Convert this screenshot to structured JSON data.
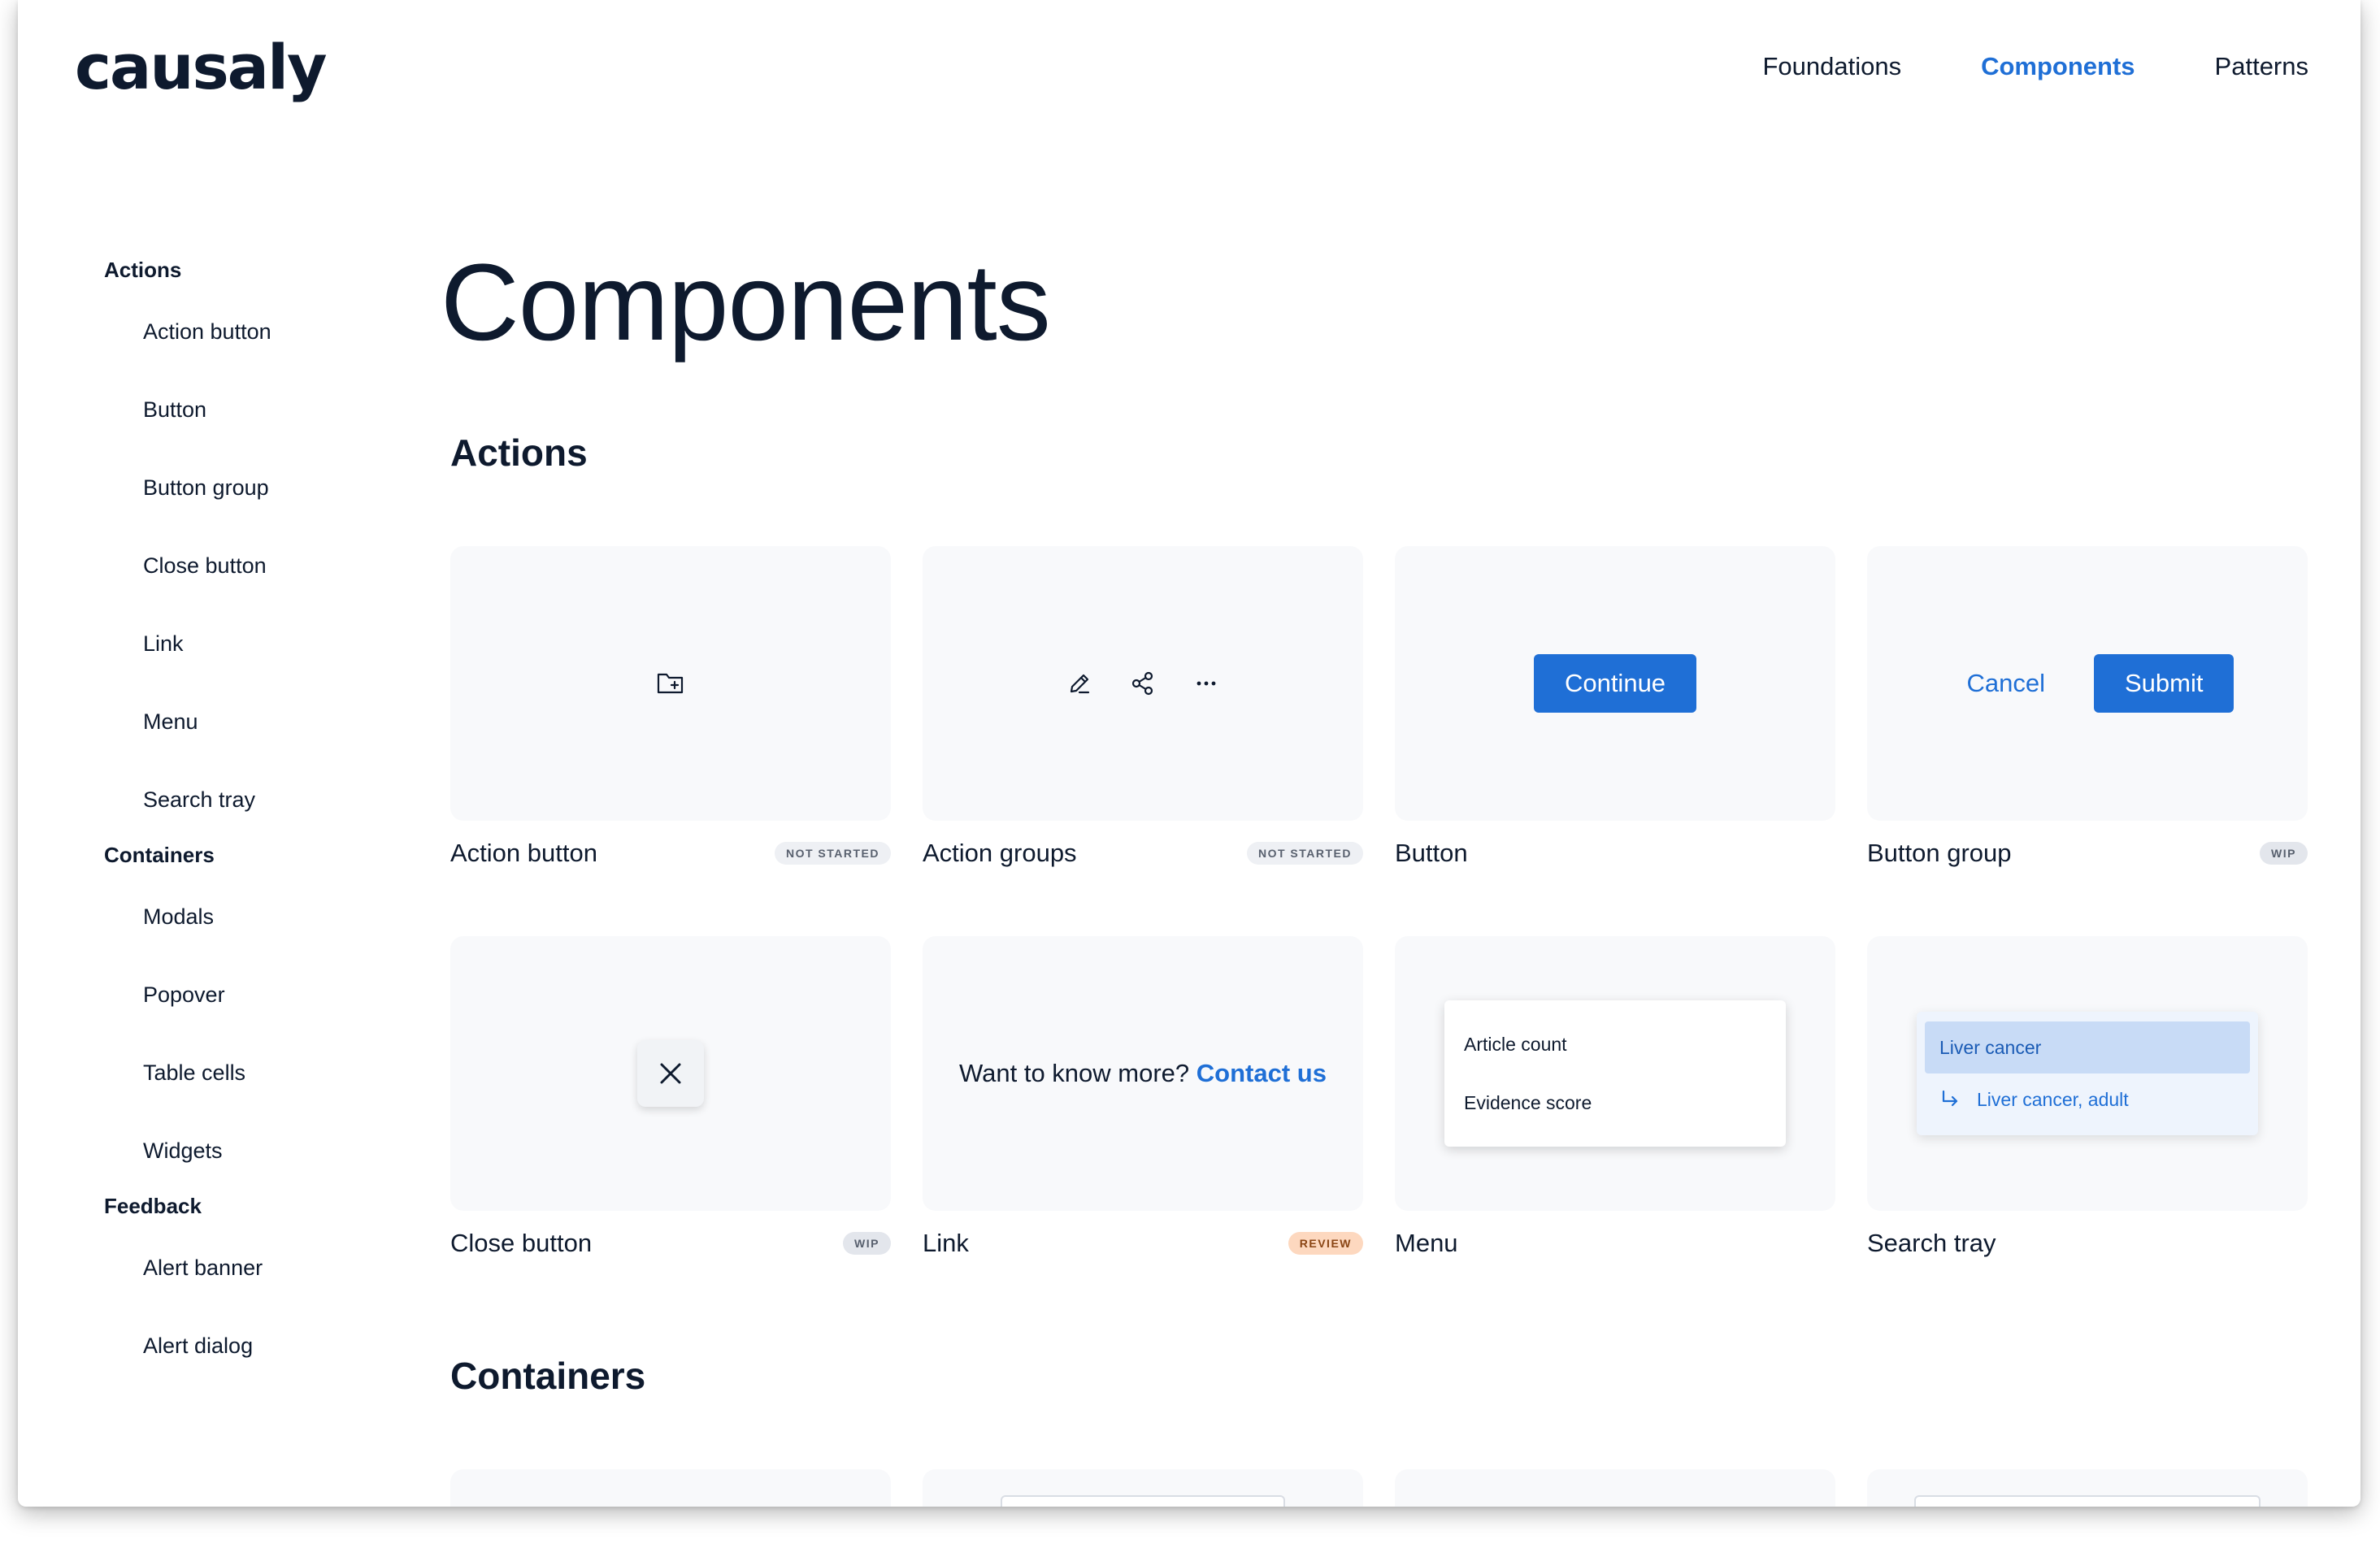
{
  "header": {
    "logo": "causaly",
    "nav": [
      {
        "label": "Foundations",
        "active": false
      },
      {
        "label": "Components",
        "active": true
      },
      {
        "label": "Patterns",
        "active": false
      }
    ]
  },
  "sidebar": {
    "groups": [
      {
        "title": "Actions",
        "items": [
          "Action button",
          "Button",
          "Button group",
          "Close button",
          "Link",
          "Menu",
          "Search tray"
        ]
      },
      {
        "title": "Containers",
        "items": [
          "Modals",
          "Popover",
          "Table cells",
          "Widgets"
        ]
      },
      {
        "title": "Feedback",
        "items": [
          "Alert banner",
          "Alert dialog"
        ]
      }
    ]
  },
  "main": {
    "title": "Components",
    "sections": [
      {
        "title": "Actions",
        "cards": [
          {
            "name": "Action button",
            "status": "NOT STARTED",
            "preview_icon": "folder-plus-icon"
          },
          {
            "name": "Action groups",
            "status": "NOT STARTED",
            "preview_icons": [
              "edit-pen-icon",
              "share-icon",
              "more-horizontal-icon"
            ]
          },
          {
            "name": "Button",
            "status": "",
            "button_label": "Continue"
          },
          {
            "name": "Button group",
            "status": "WIP",
            "cancel_label": "Cancel",
            "submit_label": "Submit"
          },
          {
            "name": "Close button",
            "status": "WIP",
            "preview_icon": "close-icon"
          },
          {
            "name": "Link",
            "status": "REVIEW",
            "text": "Want to know more?",
            "link_text": "Contact us"
          },
          {
            "name": "Menu",
            "status": "",
            "menu_items": [
              "Article count",
              "Evidence score"
            ]
          },
          {
            "name": "Search tray",
            "status": "",
            "tray_items": [
              "Liver cancer",
              "Liver cancer, adult"
            ]
          }
        ]
      },
      {
        "title": "Containers",
        "cards": []
      }
    ]
  },
  "colors": {
    "accent": "#1f6fd6",
    "text": "#0e1a2e",
    "card_bg": "#f8f9fb",
    "badge_review_bg": "#fdd8bf",
    "tray_selected_bg": "#c8dbf6"
  }
}
